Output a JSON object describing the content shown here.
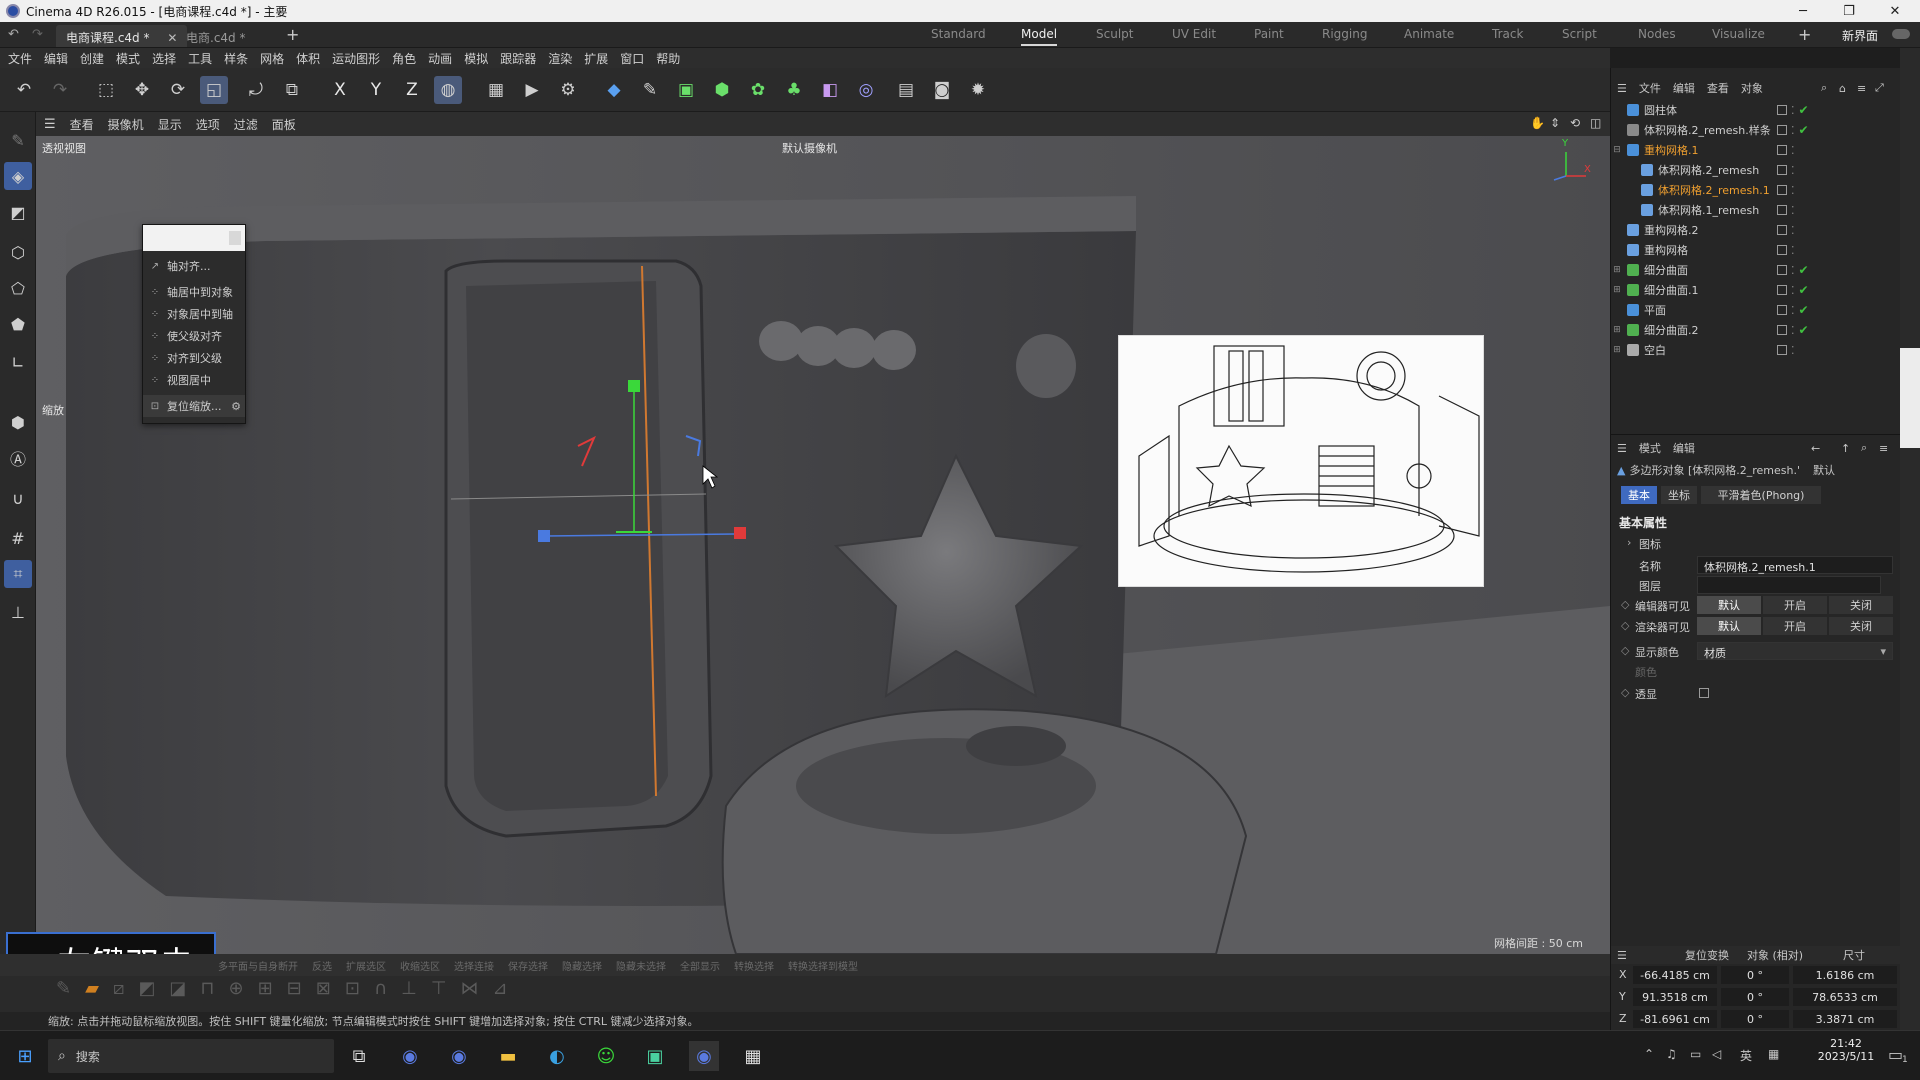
{
  "window": {
    "title": "Cinema 4D R26.015 - [电商课程.c4d *] - 主要",
    "minimize": "─",
    "maximize": "❐",
    "close": "✕"
  },
  "file_tabs": [
    {
      "label": "电商课程.c4d *",
      "active": true
    },
    {
      "label": "电商.c4d *",
      "active": false
    }
  ],
  "layout_tabs": [
    "Standard",
    "Model",
    "Sculpt",
    "UV Edit",
    "Paint",
    "Rigging",
    "Animate",
    "Track",
    "Script",
    "Nodes",
    "Visualize"
  ],
  "active_layout": "Model",
  "new_interface": "新界面",
  "menu": [
    "文件",
    "编辑",
    "创建",
    "模式",
    "选择",
    "工具",
    "样条",
    "网格",
    "体积",
    "运动图形",
    "角色",
    "动画",
    "模拟",
    "跟踪器",
    "渲染",
    "扩展",
    "窗口",
    "帮助"
  ],
  "toolbar_axes": [
    "X",
    "Y",
    "Z"
  ],
  "viewport": {
    "menu": [
      "查看",
      "摄像机",
      "显示",
      "选项",
      "过滤",
      "面板"
    ],
    "name": "透视视图",
    "camera": "默认摄像机",
    "grid_spacing": "网格间距 : 50 cm",
    "zoom_label": "缩放",
    "axis_y": "Y",
    "axis_x": "X"
  },
  "context_menu": {
    "items": [
      "轴对齐...",
      "轴居中到对象",
      "对象居中到轴",
      "使父级对齐",
      "对齐到父级",
      "视图居中",
      "复位缩放..."
    ]
  },
  "overlay_caption": "+左键双击",
  "object_manager": {
    "menu": [
      "文件",
      "编辑",
      "查看",
      "对象"
    ],
    "objects": [
      {
        "name": "圆柱体",
        "indent": 0,
        "icon_color": "#4a90d9",
        "expand": "",
        "highlight": false,
        "check": true
      },
      {
        "name": "体积网格.2_remesh.样条",
        "indent": 0,
        "icon_color": "#8a8a8a",
        "expand": "",
        "highlight": false,
        "check": true
      },
      {
        "name": "重构网格.1",
        "indent": 0,
        "icon_color": "#4a90d9",
        "expand": "⊟",
        "highlight": true,
        "check": false
      },
      {
        "name": "体积网格.2_remesh",
        "indent": 1,
        "icon_color": "#6aa0e0",
        "expand": "",
        "highlight": false,
        "check": false
      },
      {
        "name": "体积网格.2_remesh.1",
        "indent": 1,
        "icon_color": "#6aa0e0",
        "expand": "",
        "highlight": true,
        "check": false
      },
      {
        "name": "体积网格.1_remesh",
        "indent": 1,
        "icon_color": "#6aa0e0",
        "expand": "",
        "highlight": false,
        "check": false
      },
      {
        "name": "重构网格.2",
        "indent": 0,
        "icon_color": "#6aa0e0",
        "expand": "",
        "highlight": false,
        "check": false
      },
      {
        "name": "重构网格",
        "indent": 0,
        "icon_color": "#6aa0e0",
        "expand": "",
        "highlight": false,
        "check": false
      },
      {
        "name": "细分曲面",
        "indent": 0,
        "icon_color": "#50b050",
        "expand": "⊞",
        "highlight": false,
        "check": true
      },
      {
        "name": "细分曲面.1",
        "indent": 0,
        "icon_color": "#50b050",
        "expand": "⊞",
        "highlight": false,
        "check": true
      },
      {
        "name": "平面",
        "indent": 0,
        "icon_color": "#4a90d9",
        "expand": "",
        "highlight": false,
        "check": true
      },
      {
        "name": "细分曲面.2",
        "indent": 0,
        "icon_color": "#50b050",
        "expand": "⊞",
        "highlight": false,
        "check": true
      },
      {
        "name": "空白",
        "indent": 0,
        "icon_color": "#aaaaaa",
        "expand": "⊞",
        "highlight": false,
        "check": false
      }
    ]
  },
  "attributes": {
    "menu": [
      "模式",
      "编辑"
    ],
    "object_title": "多边形对象 [体积网格.2_remesh.'",
    "preset": "默认",
    "tabs": [
      "基本",
      "坐标",
      "平滑着色(Phong)"
    ],
    "section": "基本属性",
    "icon_label": "图标",
    "name_label": "名称",
    "name_value": "体积网格.2_remesh.1",
    "layer_label": "图层",
    "editor_visible_label": "编辑器可见",
    "render_visible_label": "渲染器可见",
    "visibility_options": [
      "默认",
      "开启",
      "关闭"
    ],
    "display_color_label": "显示颜色",
    "display_color_value": "材质",
    "color_label": "颜色",
    "transparent_label": "透显"
  },
  "coordinates": {
    "reset": "复位变换",
    "mode": "对象 (相对)",
    "size_mode": "尺寸",
    "rows": [
      {
        "axis": "X",
        "pos": "-66.4185 cm",
        "rot": "0 °",
        "size": "1.6186 cm"
      },
      {
        "axis": "Y",
        "pos": "91.3518 cm",
        "rot": "0 °",
        "size": "78.6533 cm"
      },
      {
        "axis": "Z",
        "pos": "-81.6961 cm",
        "rot": "0 °",
        "size": "3.3871 cm"
      }
    ]
  },
  "bottom_tool_labels": [
    "多平面与自身断开",
    "反选",
    "扩展选区",
    "收缩选区",
    "选择连接",
    "保存选择",
    "隐藏选择",
    "隐藏未选择",
    "全部显示",
    "转换选择",
    "转换选择到模型"
  ],
  "status_text": "缩放: 点击并拖动鼠标缩放视图。按住 SHIFT 键量化缩放; 节点编辑模式时按住 SHIFT 键增加选择对象; 按住 CTRL 键减少选择对象。",
  "taskbar": {
    "search_placeholder": "搜索",
    "ime": "英",
    "time": "21:42",
    "date": "2023/5/11",
    "notification_count": "1"
  }
}
